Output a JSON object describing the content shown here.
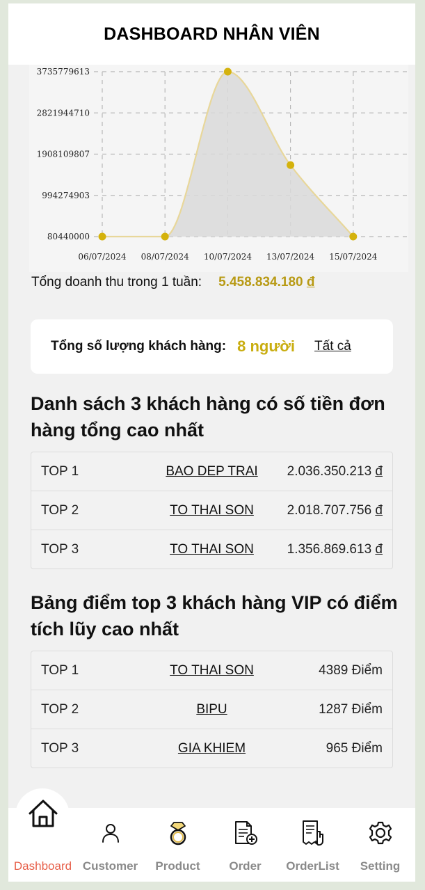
{
  "header": {
    "title": "DASHBOARD NHÂN VIÊN"
  },
  "chart_data": {
    "type": "area",
    "x": [
      "06/07/2024",
      "08/07/2024",
      "10/07/2024",
      "13/07/2024",
      "15/07/2024"
    ],
    "values": [
      80440000,
      80440000,
      3735779613,
      1665000000,
      80440000
    ],
    "yticks": [
      "80440000",
      "994274903",
      "1908109807",
      "2821944710",
      "3735779613"
    ],
    "ylim": [
      80440000,
      3735779613
    ],
    "grid": true,
    "line_color": "#e8d79a",
    "point_color": "#d4b20c",
    "fill_color": "#d9d9d9"
  },
  "revenue": {
    "label": "Tổng doanh thu trong 1 tuần:",
    "amount": "5.458.834.180",
    "currency": "đ"
  },
  "customers": {
    "label": "Tổng số lượng khách hàng:",
    "count": "8 người",
    "all_link": "Tất cả"
  },
  "top_orders": {
    "title": "Danh sách 3 khách hàng có số tiền đơn hàng tổng cao nhất",
    "rows": [
      {
        "rank": "TOP 1",
        "name": "BAO DEP TRAI",
        "amount": "2.036.350.213",
        "unit": "đ"
      },
      {
        "rank": "TOP 2",
        "name": "TO THAI SON",
        "amount": "2.018.707.756",
        "unit": "đ"
      },
      {
        "rank": "TOP 3",
        "name": "TO THAI SON",
        "amount": "1.356.869.613",
        "unit": "đ"
      }
    ]
  },
  "top_vip": {
    "title": "Bảng điểm top 3 khách hàng VIP có điểm tích lũy cao nhất",
    "rows": [
      {
        "rank": "TOP 1",
        "name": "TO THAI SON",
        "points": "4389 Điểm"
      },
      {
        "rank": "TOP 2",
        "name": "BIPU",
        "points": "1287 Điểm"
      },
      {
        "rank": "TOP 3",
        "name": "GIA KHIEM",
        "points": "965 Điểm"
      }
    ]
  },
  "nav": {
    "items": [
      {
        "label": "Dashboard",
        "icon": "home-icon"
      },
      {
        "label": "Customer",
        "icon": "user-icon"
      },
      {
        "label": "Product",
        "icon": "ring-icon"
      },
      {
        "label": "Order",
        "icon": "document-add-icon"
      },
      {
        "label": "OrderList",
        "icon": "receipt-icon"
      },
      {
        "label": "Setting",
        "icon": "gear-icon"
      }
    ],
    "active_color": "#e7604a"
  }
}
